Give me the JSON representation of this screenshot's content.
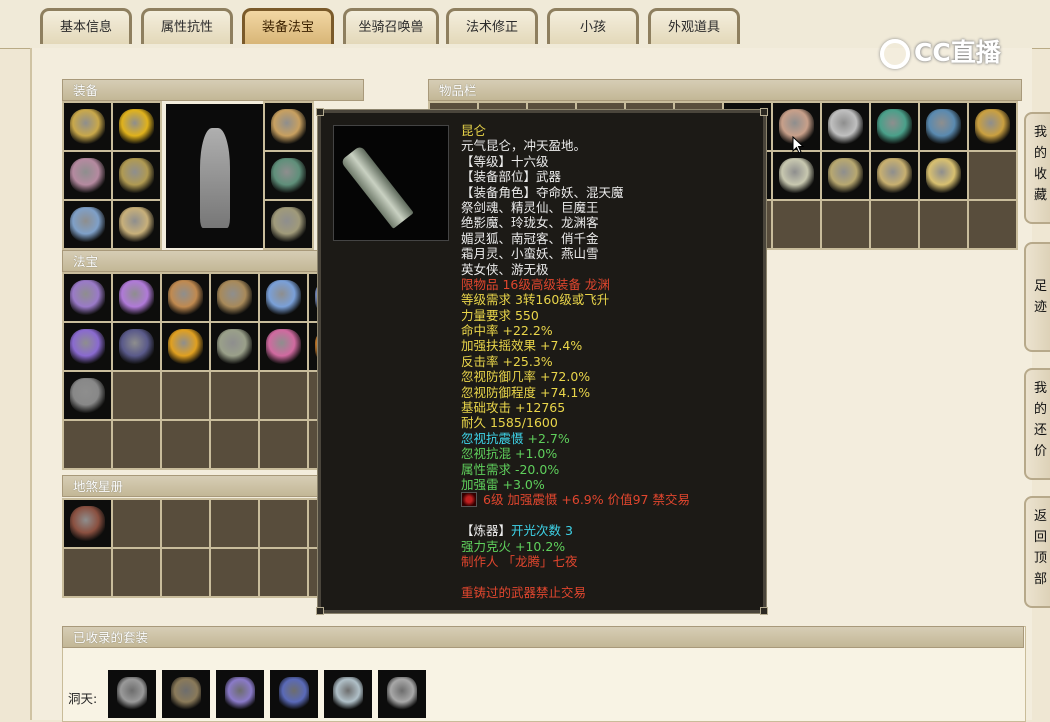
{
  "tabs": [
    {
      "label": "基本信息",
      "active": false
    },
    {
      "label": "属性抗性",
      "active": false
    },
    {
      "label": "装备法宝",
      "active": true
    },
    {
      "label": "坐骑召唤兽",
      "active": false
    },
    {
      "label": "法术修正",
      "active": false
    },
    {
      "label": "小孩",
      "active": false
    },
    {
      "label": "外观道具",
      "active": false
    }
  ],
  "logo": {
    "text": "CC直播"
  },
  "panels": {
    "equipment": "装备",
    "inventory": "物品栏",
    "treasure": "法宝",
    "star_book": "地煞星册",
    "collected_suits": "已收录的套装"
  },
  "tooltip": {
    "lines": [
      {
        "text": "昆仑",
        "color": "yellow"
      },
      {
        "text": "元气昆仑，冲天盈地。",
        "color": "white"
      },
      {
        "text": "【等级】十六级",
        "color": "white"
      },
      {
        "text": "【装备部位】武器",
        "color": "white"
      },
      {
        "text": "【装备角色】夺命妖、混天魔",
        "color": "white"
      },
      {
        "text": "祭剑魂、精灵仙、巨魔王",
        "color": "white"
      },
      {
        "text": "绝影魔、玲珑女、龙渊客",
        "color": "white"
      },
      {
        "text": "媚灵狐、南冠客、俏千金",
        "color": "white"
      },
      {
        "text": "霜月灵、小蛮妖、燕山雪",
        "color": "white"
      },
      {
        "text": "英女侠、游无极",
        "color": "white"
      },
      {
        "text": "限物品 16级高级装备 龙渊",
        "color": "red"
      },
      {
        "text": "等级需求 3转160级或飞升",
        "color": "yellow"
      },
      {
        "text": "力量要求 550",
        "color": "yellow"
      },
      {
        "text": "命中率 +22.2%",
        "color": "yellow"
      },
      {
        "text": "加强扶摇效果 +7.4%",
        "color": "yellow"
      },
      {
        "text": "反击率 +25.3%",
        "color": "yellow"
      },
      {
        "text": "忽视防御几率 +72.0%",
        "color": "yellow"
      },
      {
        "text": "忽视防御程度 +74.1%",
        "color": "yellow"
      },
      {
        "text": "基础攻击 +12765",
        "color": "yellow"
      },
      {
        "text": "耐久 1585/1600",
        "color": "yellow"
      },
      {
        "text": "忽视抗震慑 +2.7%",
        "color": "green",
        "key": "忽视抗震慑",
        "key_color": "cyan"
      },
      {
        "text": "忽视抗混 +1.0%",
        "color": "green"
      },
      {
        "text": "属性需求 -20.0%",
        "color": "green"
      },
      {
        "text": "加强雷 +3.0%",
        "color": "green"
      },
      {
        "text": "6级 加强震慑 +6.9% 价值97 禁交易",
        "color": "red",
        "gem": true
      },
      {
        "text": "",
        "color": "white"
      },
      {
        "text": "【炼器】开光次数 3",
        "color": "white",
        "key": "开光次数 3",
        "key_color": "cyan"
      },
      {
        "text": "强力克火 +10.2%",
        "color": "green"
      },
      {
        "text": "制作人 「龙腾」七夜",
        "color": "red"
      },
      {
        "text": "",
        "color": "white"
      },
      {
        "text": "重铸过的武器禁止交易",
        "color": "red"
      }
    ]
  },
  "sidebar": [
    {
      "label": "我的收藏"
    },
    {
      "label": "足迹"
    },
    {
      "label": "我的还价"
    },
    {
      "label": "返回顶部"
    }
  ],
  "suits": {
    "label": "洞天:"
  },
  "item_colors": {
    "equipment": [
      "#c9a84a",
      "#e0b21c",
      "#b58aa0",
      "#b09a52",
      "#7fa0c8",
      "#c8b07a"
    ],
    "equipment_right": [
      "#c8a060",
      "#5f8f7a",
      "#a09a7a"
    ],
    "treasure": [
      "#9a7ac8",
      "#b07ad8",
      "#c08a50",
      "#a88a5a",
      "#7aa0d8",
      "#8aa0d8",
      "#8a6ad0",
      "#5a5a8a",
      "#e0a020",
      "#9aa08a",
      "#d06aa0",
      "#e08a30",
      "#888888"
    ],
    "inventory": [
      "#b0b0b0",
      "#c8a08a",
      "#c0c0c0",
      "#4aa08a",
      "#5a8ab0",
      "#caa040",
      "#caa040",
      "#c8c8b0",
      "#b8a870",
      "#c8b070",
      "#d8c070"
    ],
    "star_book": [
      "#8a5040"
    ],
    "suits": [
      "#9a9a9a",
      "#8a7a5a",
      "#8a7ac8",
      "#5a6ab8",
      "#b0c0c8",
      "#a8a8a8"
    ]
  }
}
